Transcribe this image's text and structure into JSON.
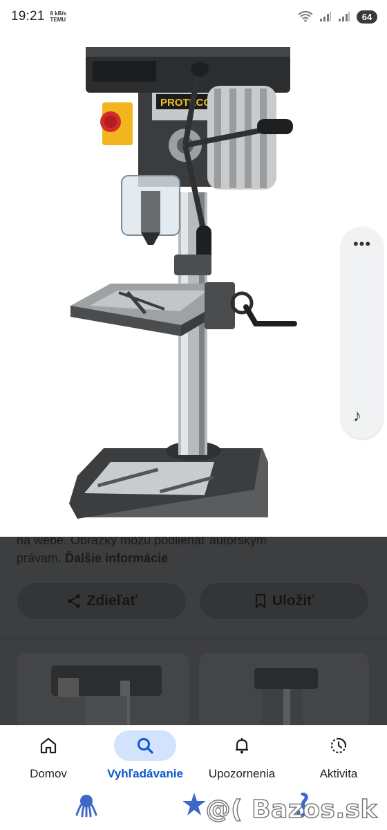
{
  "status_bar": {
    "time": "19:21",
    "speed_value": "8 kB/s",
    "app_hint": "TEMU",
    "battery": "64",
    "icons": [
      "wifi-icon",
      "signal-icon",
      "signal-icon-2"
    ]
  },
  "image": {
    "brand_label": "PROTECO",
    "plate_text": "PROTECO"
  },
  "side_panel": {
    "more_label": "•••",
    "icons": [
      "more-icon",
      "music-note-icon"
    ]
  },
  "details": {
    "notice_text": "na webe. Obrázky môžu podliehať autorským právam.",
    "more_info_link": "Ďalšie informácie",
    "share_label": "Zdieľať",
    "save_label": "Uložiť"
  },
  "bottom_nav": {
    "items": [
      {
        "label": "Domov",
        "icon": "home-icon",
        "active": false
      },
      {
        "label": "Vyhľadávanie",
        "icon": "search-icon",
        "active": true
      },
      {
        "label": "Upozornenia",
        "icon": "bell-icon",
        "active": false
      },
      {
        "label": "Aktivita",
        "icon": "activity-icon",
        "active": false
      }
    ]
  },
  "watermark": "@( Bazos.sk",
  "colors": {
    "accent": "#0b57d0",
    "active_pill": "#d3e3fd",
    "overlay": "#3d3e40"
  }
}
